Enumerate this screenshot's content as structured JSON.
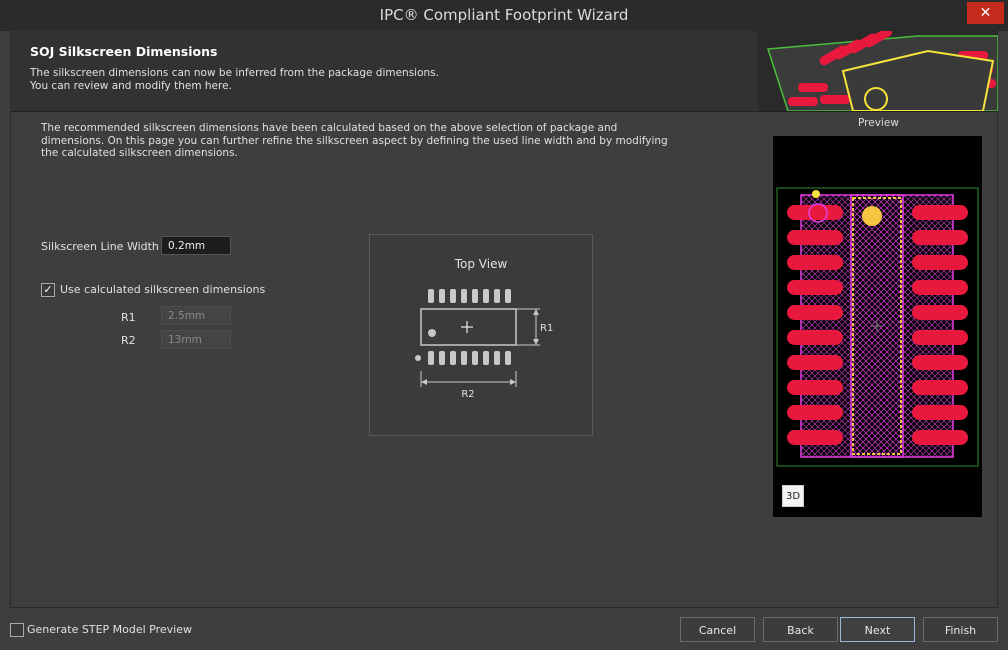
{
  "window": {
    "title": "IPC® Compliant Footprint Wizard",
    "close_glyph": "✕"
  },
  "header": {
    "title": "SOJ Silkscreen Dimensions",
    "line1": "The silkscreen dimensions can now be inferred from the package dimensions.",
    "line2": "You can review and modify them here."
  },
  "intro": "The recommended silkscreen dimensions have been calculated based on the above selection of package and dimensions. On this page you can further refine the silkscreen aspect by defining the used line width and by modifying the calculated silkscreen dimensions.",
  "form": {
    "line_width_label": "Silkscreen Line Width",
    "line_width_value": "0.2mm",
    "use_calculated_label": "Use calculated silkscreen dimensions",
    "use_calculated_checked": "✓",
    "r1_label": "R1",
    "r1_value": "2.5mm",
    "r2_label": "R2",
    "r2_value": "13mm"
  },
  "top_view": {
    "title": "Top View",
    "r1": "R1",
    "r2": "R2"
  },
  "preview": {
    "label": "Preview",
    "btn_3d": "3D"
  },
  "footer": {
    "generate_step_label": "Generate STEP Model Preview",
    "cancel": "Cancel",
    "back": "Back",
    "next": "Next",
    "finish": "Finish"
  },
  "colors": {
    "pad": "#e8193c",
    "silk": "#e63ee6",
    "pin1": "#f5c542",
    "board_outline": "#39c24a"
  }
}
